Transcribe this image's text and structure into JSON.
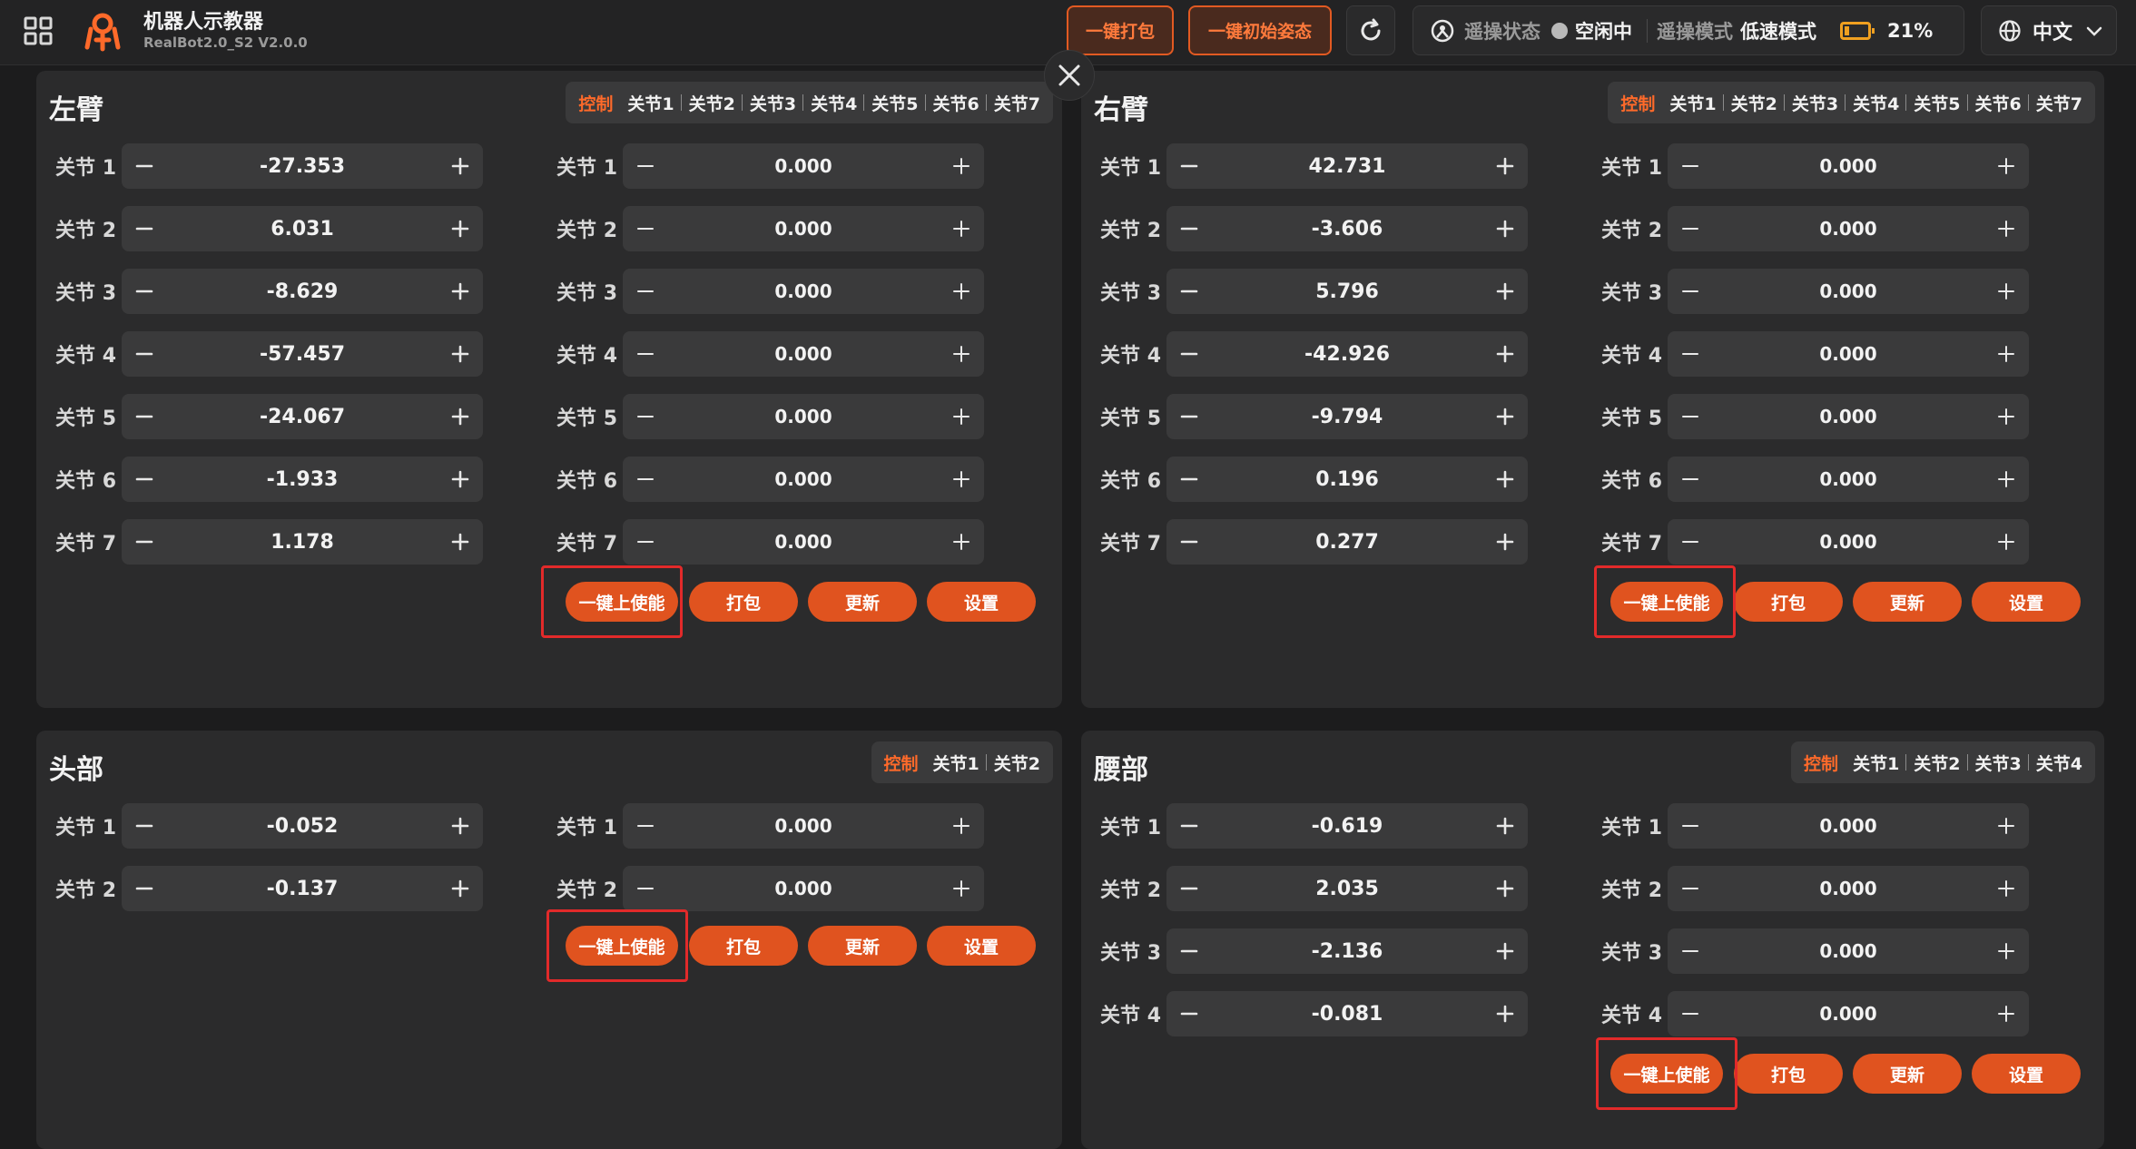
{
  "header": {
    "app_title": "机器人示教器",
    "app_version": "RealBot2.0_S2 V2.0.0",
    "pack_all_label": "一键打包",
    "init_pose_label": "一键初始姿态",
    "teleop_status_label": "遥操状态",
    "teleop_status_value": "空闲中",
    "teleop_mode_label": "遥操模式",
    "teleop_mode_value": "低速模式",
    "battery_percent": "21%",
    "battery_fraction": 0.21,
    "language": "中文",
    "accent_color": "#e0531f",
    "icons": [
      "grid-menu-icon",
      "logo-icon",
      "refresh-icon",
      "teleop-status-icon",
      "battery-icon",
      "globe-icon",
      "chevron-down-icon",
      "close-icon",
      "minus-icon",
      "plus-icon"
    ]
  },
  "buttons": {
    "enable": "一键上使能",
    "pack": "打包",
    "update": "更新",
    "settings": "设置"
  },
  "left_arm": {
    "title": "左臂",
    "tabs": [
      "控制",
      "关节1",
      "关节2",
      "关节3",
      "关节4",
      "关节5",
      "关节6",
      "关节7"
    ],
    "left_joints": [
      {
        "label": "关节 1",
        "value": "-27.353"
      },
      {
        "label": "关节 2",
        "value": "6.031"
      },
      {
        "label": "关节 3",
        "value": "-8.629"
      },
      {
        "label": "关节 4",
        "value": "-57.457"
      },
      {
        "label": "关节 5",
        "value": "-24.067"
      },
      {
        "label": "关节 6",
        "value": "-1.933"
      },
      {
        "label": "关节 7",
        "value": "1.178"
      }
    ],
    "right_joints": [
      {
        "label": "关节 1",
        "value": "0.000"
      },
      {
        "label": "关节 2",
        "value": "0.000"
      },
      {
        "label": "关节 3",
        "value": "0.000"
      },
      {
        "label": "关节 4",
        "value": "0.000"
      },
      {
        "label": "关节 5",
        "value": "0.000"
      },
      {
        "label": "关节 6",
        "value": "0.000"
      },
      {
        "label": "关节 7",
        "value": "0.000"
      }
    ]
  },
  "right_arm": {
    "title": "右臂",
    "tabs": [
      "控制",
      "关节1",
      "关节2",
      "关节3",
      "关节4",
      "关节5",
      "关节6",
      "关节7"
    ],
    "left_joints": [
      {
        "label": "关节 1",
        "value": "42.731"
      },
      {
        "label": "关节 2",
        "value": "-3.606"
      },
      {
        "label": "关节 3",
        "value": "5.796"
      },
      {
        "label": "关节 4",
        "value": "-42.926"
      },
      {
        "label": "关节 5",
        "value": "-9.794"
      },
      {
        "label": "关节 6",
        "value": "0.196"
      },
      {
        "label": "关节 7",
        "value": "0.277"
      }
    ],
    "right_joints": [
      {
        "label": "关节 1",
        "value": "0.000"
      },
      {
        "label": "关节 2",
        "value": "0.000"
      },
      {
        "label": "关节 3",
        "value": "0.000"
      },
      {
        "label": "关节 4",
        "value": "0.000"
      },
      {
        "label": "关节 5",
        "value": "0.000"
      },
      {
        "label": "关节 6",
        "value": "0.000"
      },
      {
        "label": "关节 7",
        "value": "0.000"
      }
    ]
  },
  "head": {
    "title": "头部",
    "tabs": [
      "控制",
      "关节1",
      "关节2"
    ],
    "left_joints": [
      {
        "label": "关节 1",
        "value": "-0.052"
      },
      {
        "label": "关节 2",
        "value": "-0.137"
      }
    ],
    "right_joints": [
      {
        "label": "关节 1",
        "value": "0.000"
      },
      {
        "label": "关节 2",
        "value": "0.000"
      }
    ]
  },
  "waist": {
    "title": "腰部",
    "tabs": [
      "控制",
      "关节1",
      "关节2",
      "关节3",
      "关节4"
    ],
    "left_joints": [
      {
        "label": "关节 1",
        "value": "-0.619"
      },
      {
        "label": "关节 2",
        "value": "2.035"
      },
      {
        "label": "关节 3",
        "value": "-2.136"
      },
      {
        "label": "关节 4",
        "value": "-0.081"
      }
    ],
    "right_joints": [
      {
        "label": "关节 1",
        "value": "0.000"
      },
      {
        "label": "关节 2",
        "value": "0.000"
      },
      {
        "label": "关节 3",
        "value": "0.000"
      },
      {
        "label": "关节 4",
        "value": "0.000"
      }
    ]
  }
}
